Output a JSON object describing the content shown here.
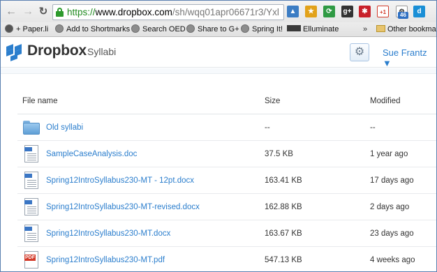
{
  "browser": {
    "url": {
      "scheme": "https://",
      "host": "www.dropbox.com",
      "path": "/sh/wqq01apr06671r3/Yxl"
    },
    "extension_badge": "46",
    "bookmarks": [
      {
        "label": "+ Paper.li",
        "icon": "paper-li-icon"
      },
      {
        "label": "Add to Shortmarks",
        "icon": "globe-icon"
      },
      {
        "label": "Search OED",
        "icon": "globe-icon"
      },
      {
        "label": "Share to G+",
        "icon": "globe-icon"
      },
      {
        "label": "Spring It!",
        "icon": "globe-icon"
      },
      {
        "label": "Elluminate",
        "icon": "elluminate-icon"
      }
    ],
    "overflow_label": "»",
    "other_bookmarks": "Other bookmar"
  },
  "header": {
    "brand": "Dropbox",
    "breadcrumb": "Syllabi",
    "user": "Sue Frantz ▼",
    "brand_color": "#2b7ecd"
  },
  "table": {
    "columns": {
      "name": "File name",
      "size": "Size",
      "modified": "Modified"
    },
    "rows": [
      {
        "type": "folder",
        "name": "Old syllabi",
        "size": "--",
        "modified": "--"
      },
      {
        "type": "doc",
        "name": "SampleCaseAnalysis.doc",
        "size": "37.5 KB",
        "modified": "1 year ago"
      },
      {
        "type": "doc",
        "name": "Spring12IntroSyllabus230-MT - 12pt.docx",
        "size": "163.41 KB",
        "modified": "17 days ago"
      },
      {
        "type": "doc",
        "name": "Spring12IntroSyllabus230-MT-revised.docx",
        "size": "162.88 KB",
        "modified": "2 days ago"
      },
      {
        "type": "doc",
        "name": "Spring12IntroSyllabus230-MT.docx",
        "size": "163.67 KB",
        "modified": "23 days ago"
      },
      {
        "type": "pdf",
        "name": "Spring12IntroSyllabus230-MT.pdf",
        "size": "547.13 KB",
        "modified": "4 weeks ago"
      }
    ]
  }
}
